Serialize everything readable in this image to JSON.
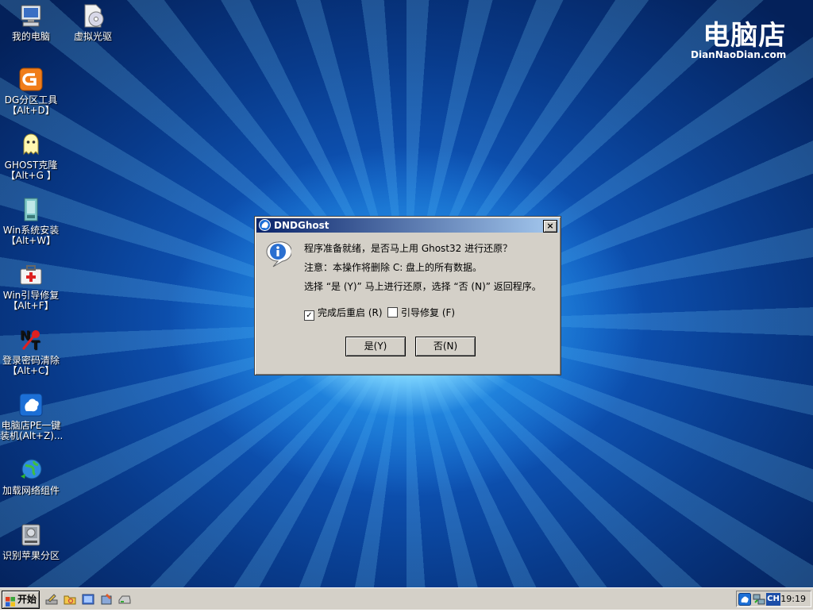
{
  "desktop": {
    "icons": [
      {
        "label1": "我的电脑",
        "label2": ""
      },
      {
        "label1": "虚拟光驱",
        "label2": ""
      },
      {
        "label1": "DG分区工具",
        "label2": "【Alt+D】"
      },
      {
        "label1": "GHOST克隆",
        "label2": "【Alt+G 】"
      },
      {
        "label1": "Win系统安装",
        "label2": "【Alt+W】"
      },
      {
        "label1": "Win引导修复",
        "label2": "【Alt+F】"
      },
      {
        "label1": "登录密码清除",
        "label2": "【Alt+C】"
      },
      {
        "label1": "电脑店PE一键",
        "label2": "装机(Alt+Z)..."
      },
      {
        "label1": "加载网络组件",
        "label2": ""
      },
      {
        "label1": "识别苹果分区",
        "label2": ""
      }
    ],
    "logo": {
      "big": "电脑店",
      "small": "DianNaoDian.com"
    }
  },
  "dialog": {
    "title": "DNDGhost",
    "close_label": "×",
    "line1": "程序准备就绪，是否马上用 Ghost32 进行还原？",
    "line2": "注意：本操作将删除 C: 盘上的所有数据。",
    "line3": "选择 “是 (Y)” 马上进行还原，选择 “否 (N)” 返回程序。",
    "checkbox_restart": {
      "label": "完成后重启 (R)",
      "checked": true
    },
    "checkbox_bootfix": {
      "label": "引导修复 (F)",
      "checked": false
    },
    "yes_label": "是(Y)",
    "no_label": "否(N)"
  },
  "taskbar": {
    "start_label": "开始",
    "tray_lang": "CH",
    "clock": "19:19"
  },
  "colors": {
    "dialog_bg": "#d4d0c8",
    "title_start": "#0a246a",
    "title_end": "#a6caf0"
  }
}
